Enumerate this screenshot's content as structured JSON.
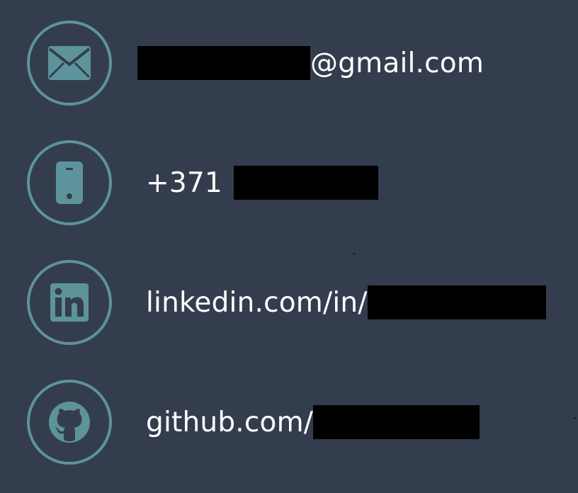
{
  "contacts": {
    "email": {
      "icon": "envelope-icon",
      "suffix": "@gmail.com"
    },
    "phone": {
      "icon": "phone-icon",
      "prefix": "+371"
    },
    "linkedin": {
      "icon": "linkedin-icon",
      "prefix": "linkedin.com/in/"
    },
    "github": {
      "icon": "github-icon",
      "prefix": "github.com/"
    }
  },
  "colors": {
    "background": "#343d4e",
    "accent": "#5d949b",
    "text": "#ffffff",
    "redaction": "#000000"
  }
}
